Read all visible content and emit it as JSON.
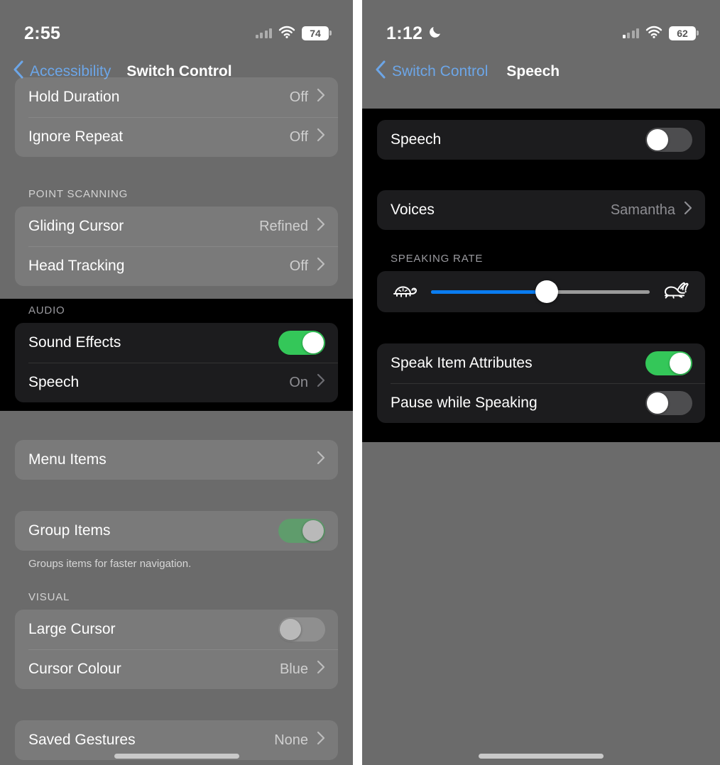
{
  "left_phone": {
    "status_bar": {
      "time": "2:55",
      "signal_icon": "signal-bars-dim-icon",
      "wifi_icon": "wifi-icon",
      "battery_level": "74"
    },
    "nav": {
      "back_label": "Accessibility",
      "back_icon": "chevron-left-icon",
      "title": "Switch Control"
    },
    "rows_top": [
      {
        "label": "Hold Duration",
        "value": "Off",
        "accessory": "chevron-right-icon"
      },
      {
        "label": "Ignore Repeat",
        "value": "Off",
        "accessory": "chevron-right-icon"
      }
    ],
    "point_scanning": {
      "header": "POINT SCANNING",
      "rows": [
        {
          "label": "Gliding Cursor",
          "value": "Refined",
          "accessory": "chevron-right-icon"
        },
        {
          "label": "Head Tracking",
          "value": "Off",
          "accessory": "chevron-right-icon"
        }
      ]
    },
    "audio": {
      "header": "AUDIO",
      "rows": [
        {
          "label": "Sound Effects",
          "toggle": "on"
        },
        {
          "label": "Speech",
          "value": "On",
          "accessory": "chevron-right-icon"
        }
      ]
    },
    "menu_items": {
      "label": "Menu Items",
      "accessory": "chevron-right-icon"
    },
    "group_items": {
      "label": "Group Items",
      "toggle": "on",
      "footnote": "Groups items for faster navigation."
    },
    "visual": {
      "header": "VISUAL",
      "rows": [
        {
          "label": "Large Cursor",
          "toggle": "off"
        },
        {
          "label": "Cursor Colour",
          "value": "Blue",
          "accessory": "chevron-right-icon"
        }
      ]
    },
    "saved_gestures": {
      "label": "Saved Gestures",
      "value": "None",
      "accessory": "chevron-right-icon"
    }
  },
  "right_phone": {
    "status_bar": {
      "time": "1:12",
      "focus_icon": "moon-icon",
      "signal_icon": "signal-bars-partial-icon",
      "wifi_icon": "wifi-icon",
      "battery_level": "62"
    },
    "nav": {
      "back_label": "Switch Control",
      "back_icon": "chevron-left-icon",
      "title": "Speech"
    },
    "speech_toggle_row": {
      "label": "Speech",
      "toggle": "off"
    },
    "voices_row": {
      "label": "Voices",
      "value": "Samantha",
      "accessory": "chevron-right-icon"
    },
    "speaking_rate": {
      "header": "SPEAKING RATE",
      "min_icon": "tortoise-icon",
      "max_icon": "hare-icon",
      "value_percent": 53
    },
    "options": [
      {
        "label": "Speak Item Attributes",
        "toggle": "on"
      },
      {
        "label": "Pause while Speaking",
        "toggle": "off"
      }
    ]
  },
  "colors": {
    "toggle_on_green": "#34c759",
    "slider_fill_blue": "#0a7cf0",
    "link_blue": "#6ca6e8",
    "highlight_black": "#000000",
    "dim_wash": "#6b6b6b"
  }
}
